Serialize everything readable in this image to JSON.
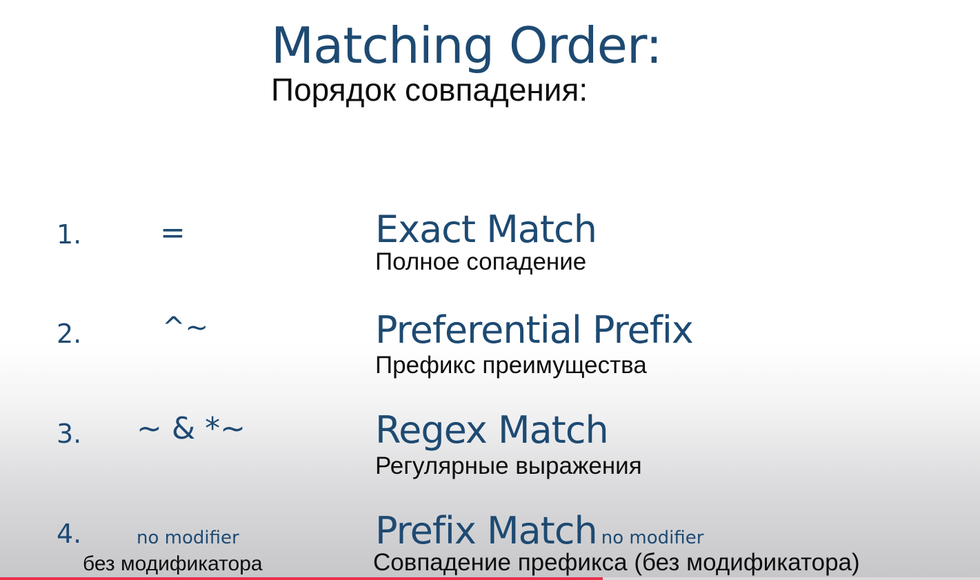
{
  "slide": {
    "title": "Matching Order:",
    "subtitle": "Порядок совпадения:",
    "items": [
      {
        "number": "1.",
        "modifier": "=",
        "name": "Exact Match",
        "translation": "Полное сопадение"
      },
      {
        "number": "2.",
        "modifier": "^~",
        "name": "Preferential Prefix",
        "translation": "Префикс преимущества"
      },
      {
        "number": "3.",
        "modifier": "~ & *~",
        "name": "Regex Match",
        "translation": "Регулярные выражения"
      },
      {
        "number": "4.",
        "modifier": "no modifier",
        "modifier_translation": "без модификатора",
        "name": "Prefix Match",
        "name_note": "no modifier",
        "translation": "Совпадение префикса (без модификатора)"
      }
    ]
  },
  "video_progress": {
    "fraction": 0.615,
    "color": "#e8304a"
  },
  "colors": {
    "accent": "#1e4a72",
    "text": "#0d0d0d"
  }
}
